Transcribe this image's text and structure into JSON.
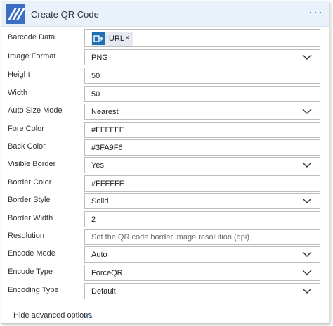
{
  "header": {
    "title": "Create QR Code",
    "more_label": "···",
    "accent_color": "#3a6fc4",
    "icon": "action-stripes-icon"
  },
  "fields": {
    "barcode_data": {
      "label": "Barcode Data",
      "token_label": "URL",
      "token_icon": "dynamic-content-icon",
      "token_icon_text": "→",
      "remove_label": "×"
    },
    "image_format": {
      "label": "Image Format",
      "value": "PNG"
    },
    "height": {
      "label": "Height",
      "value": "50"
    },
    "width": {
      "label": "Width",
      "value": "50"
    },
    "auto_size_mode": {
      "label": "Auto Size Mode",
      "value": "Nearest"
    },
    "fore_color": {
      "label": "Fore Color",
      "value": "#FFFFFF"
    },
    "back_color": {
      "label": "Back Color",
      "value": "#3FA9F6"
    },
    "visible_border": {
      "label": "Visible Border",
      "value": "Yes"
    },
    "border_color": {
      "label": "Border Color",
      "value": "#FFFFFF"
    },
    "border_style": {
      "label": "Border Style",
      "value": "Solid"
    },
    "border_width": {
      "label": "Border Width",
      "value": "2"
    },
    "resolution": {
      "label": "Resolution",
      "placeholder": "Set the QR code border image resolution (dpi)"
    },
    "encode_mode": {
      "label": "Encode Mode",
      "value": "Auto"
    },
    "encode_type": {
      "label": "Encode Type",
      "value": "ForceQR"
    },
    "encoding_type": {
      "label": "Encoding Type",
      "value": "Default"
    }
  },
  "footer": {
    "toggle_label": "Hide advanced options"
  }
}
